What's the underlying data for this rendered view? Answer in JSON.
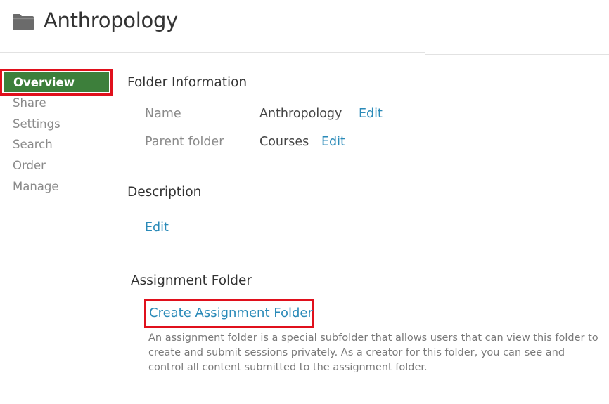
{
  "header": {
    "title": "Anthropology",
    "icon": "folder-icon"
  },
  "sidebar": {
    "active_color": "#3d7f3b",
    "items": [
      {
        "label": "Overview",
        "active": true
      },
      {
        "label": "Share"
      },
      {
        "label": "Settings"
      },
      {
        "label": "Search"
      },
      {
        "label": "Order"
      },
      {
        "label": "Manage"
      }
    ]
  },
  "folder_info": {
    "heading": "Folder Information",
    "name_label": "Name",
    "name_value": "Anthropology",
    "name_edit": "Edit",
    "parent_label": "Parent folder",
    "parent_value": "Courses",
    "parent_edit": "Edit"
  },
  "description": {
    "heading": "Description",
    "edit": "Edit"
  },
  "assignment": {
    "heading": "Assignment Folder",
    "create_label": "Create Assignment Folder",
    "help_text": "An assignment folder is a special subfolder that allows users that can view this folder to create and submit sessions privately. As a creator for this folder, you can see and control all content submitted to the assignment folder."
  },
  "colors": {
    "link": "#2a8ab8",
    "highlight": "#e0101c"
  }
}
